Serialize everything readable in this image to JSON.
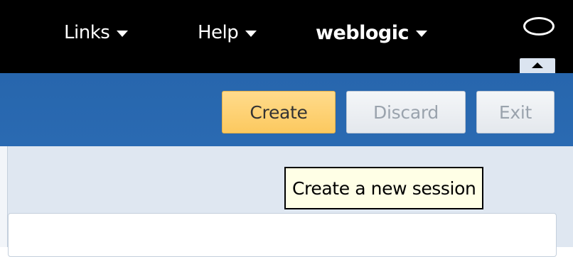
{
  "header": {
    "menus": [
      {
        "label": "Links"
      },
      {
        "label": "Help"
      },
      {
        "label": "weblogic"
      }
    ]
  },
  "toolbar": {
    "create_label": "Create",
    "discard_label": "Discard",
    "exit_label": "Exit"
  },
  "tooltip": {
    "text": "Create a new session"
  },
  "icons": {
    "caret": "caret-down-icon",
    "oval": "oval-icon",
    "collapse": "collapse-up-icon"
  },
  "colors": {
    "topbar": "#000000",
    "bluebar": "#2968b0",
    "create_button": "#fcd06f",
    "tooltip_bg": "#ffffe6"
  }
}
